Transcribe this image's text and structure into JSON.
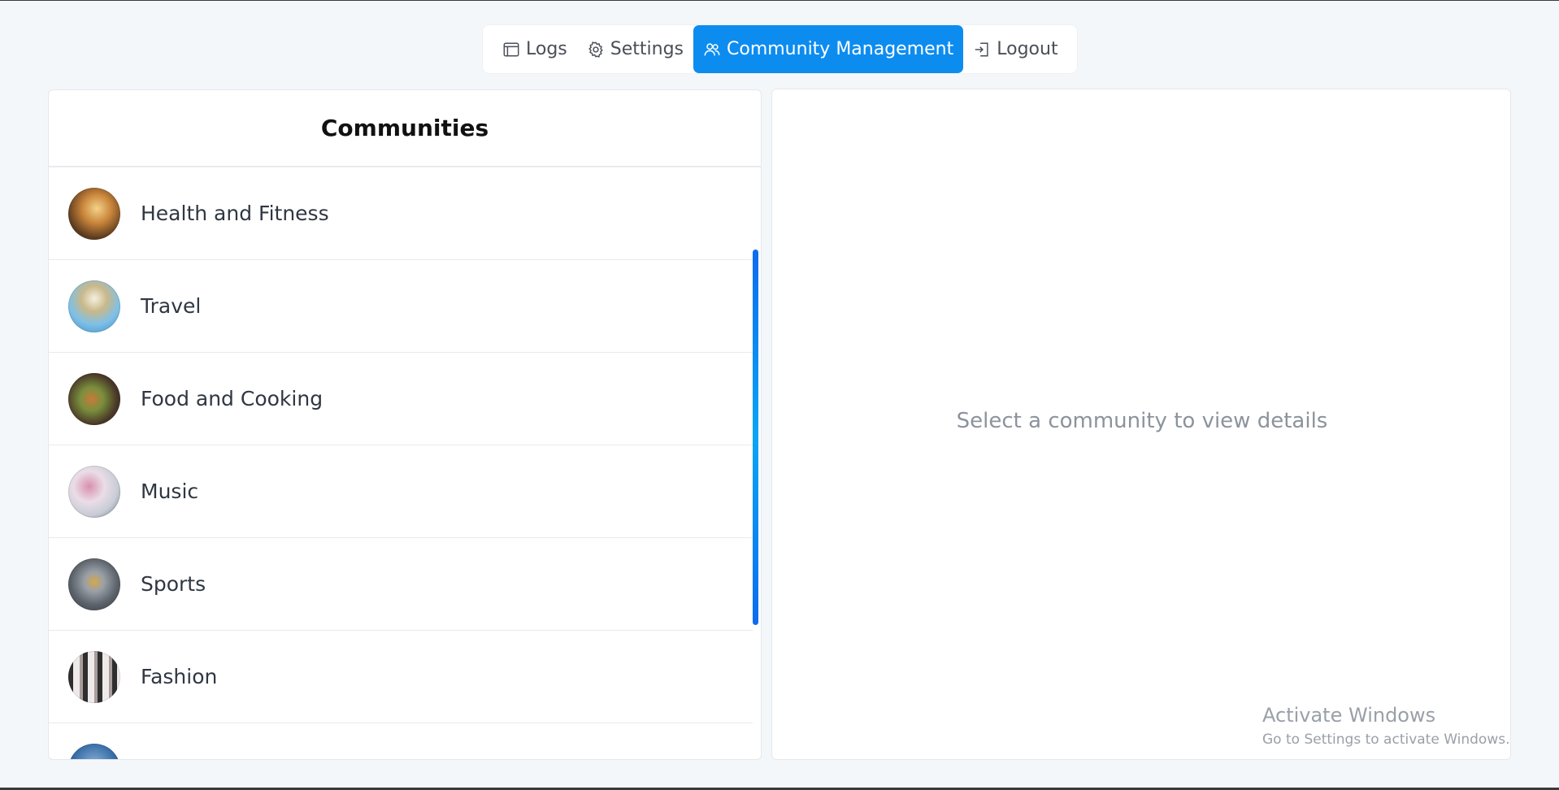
{
  "nav": {
    "items": [
      {
        "label": "Logs",
        "icon": "browser-window-icon",
        "active": false
      },
      {
        "label": "Settings",
        "icon": "gear-icon",
        "active": false
      },
      {
        "label": "Community Management",
        "icon": "users-icon",
        "active": true
      },
      {
        "label": "Logout",
        "icon": "logout-icon",
        "active": false
      }
    ],
    "accent_color": "#0d8cf0"
  },
  "communities": {
    "title": "Communities",
    "items": [
      {
        "label": "Health and Fitness",
        "avatar_colors": [
          "#e8b060",
          "#7a4a22",
          "#2f6a52"
        ]
      },
      {
        "label": "Travel",
        "avatar_colors": [
          "#bfe0f0",
          "#4aa0d8",
          "#d8c090"
        ]
      },
      {
        "label": "Food and Cooking",
        "avatar_colors": [
          "#3a3026",
          "#b06a32",
          "#6f8a3a"
        ]
      },
      {
        "label": "Music",
        "avatar_colors": [
          "#f2eef4",
          "#c47a9a",
          "#6d7f9a"
        ]
      },
      {
        "label": "Sports",
        "avatar_colors": [
          "#8a8f96",
          "#3f454c",
          "#c59a3a"
        ]
      },
      {
        "label": "Fashion",
        "avatar_colors": [
          "#f0eeee",
          "#3a3a3a",
          "#b0a6a6"
        ]
      },
      {
        "label": "",
        "avatar_colors": [
          "#3a6fa8",
          "#8ab0d8",
          "#1d3a5a"
        ]
      }
    ]
  },
  "details": {
    "placeholder": "Select a community to view details"
  },
  "watermark": {
    "title": "Activate Windows",
    "subtitle": "Go to Settings to activate Windows."
  }
}
